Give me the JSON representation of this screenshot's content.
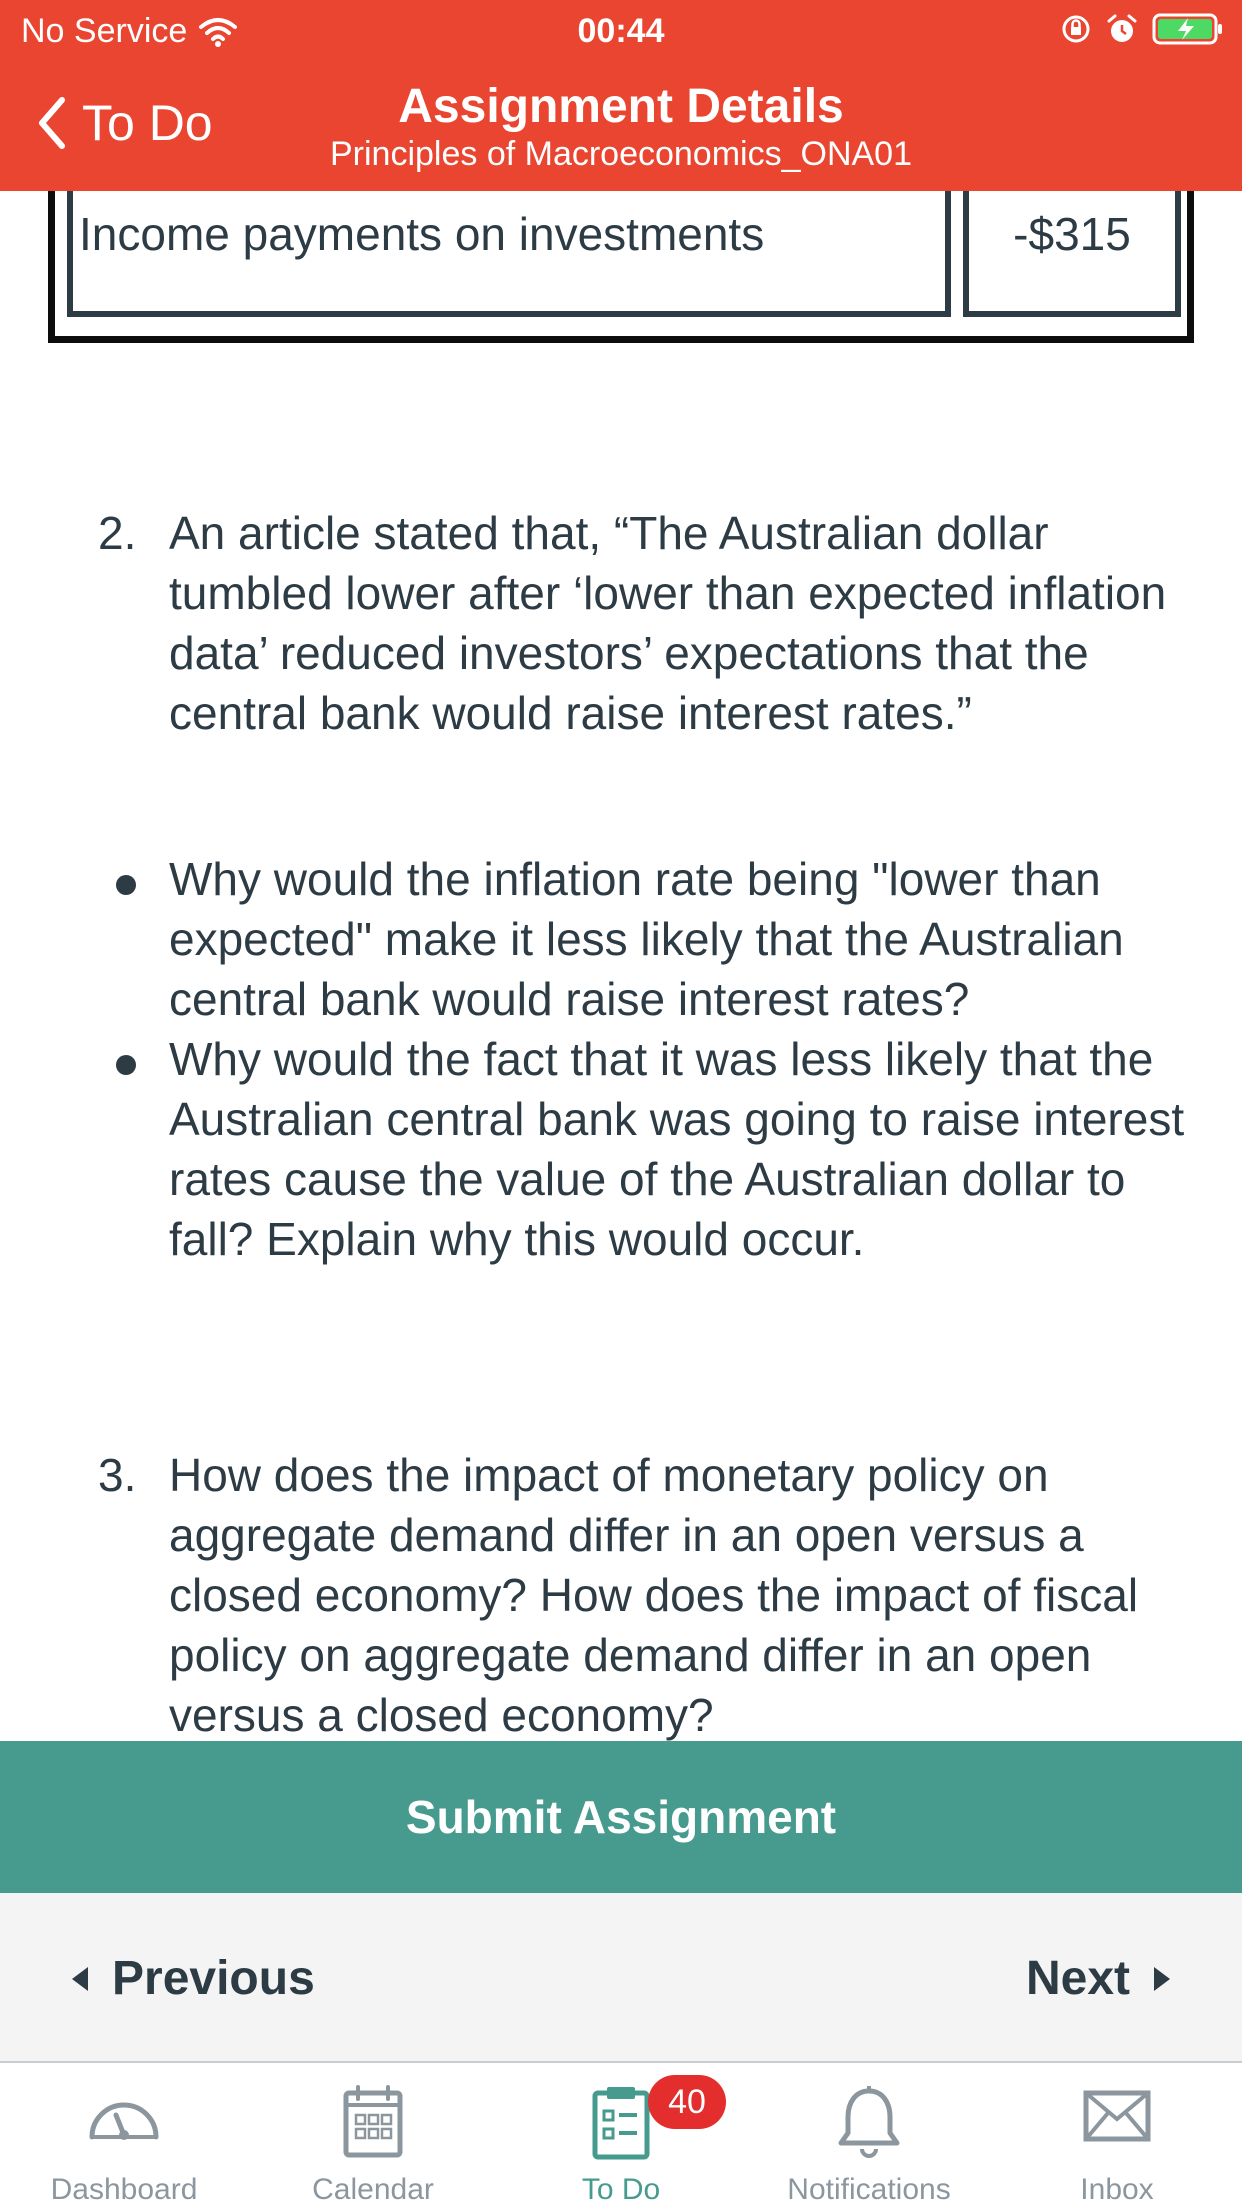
{
  "status_bar": {
    "carrier": "No Service",
    "time": "00:44"
  },
  "nav": {
    "back_label": "To Do",
    "title": "Assignment Details",
    "subtitle": "Principles of Macroeconomics_ONA01"
  },
  "table": {
    "label": "Income payments on investments",
    "value": "-$315"
  },
  "questions": [
    {
      "number": "2.",
      "text": "An article stated that, “The Australian dollar tumbled lower after ‘lower than expected inflation data’ reduced investors’ expectations that the central bank would raise interest rates.”"
    },
    {
      "number": "3.",
      "text": "How does the impact of monetary policy on aggregate demand differ in an open versus a closed economy? How does the impact of fiscal policy on aggregate demand differ in an open versus a closed economy?"
    }
  ],
  "bullets": [
    "Why would the inflation rate being \"lower than expected\" make it less likely that the Australian central bank would raise interest rates?",
    "Why would the fact that it was less likely that the Australian central bank was going to raise interest rates cause the value of the Australian dollar to fall? Explain why this would occur."
  ],
  "submit_label": "Submit Assignment",
  "pager": {
    "previous": "Previous",
    "next": "Next"
  },
  "tabs": [
    {
      "label": "Dashboard",
      "icon": "dashboard-icon"
    },
    {
      "label": "Calendar",
      "icon": "calendar-icon"
    },
    {
      "label": "To Do",
      "icon": "todo-icon",
      "badge": "40",
      "active": true
    },
    {
      "label": "Notifications",
      "icon": "bell-icon"
    },
    {
      "label": "Inbox",
      "icon": "mail-icon"
    }
  ],
  "colors": {
    "header": "#e94530",
    "submit": "#469b8e",
    "text": "#2d3b45",
    "badge": "#e42d2d"
  }
}
